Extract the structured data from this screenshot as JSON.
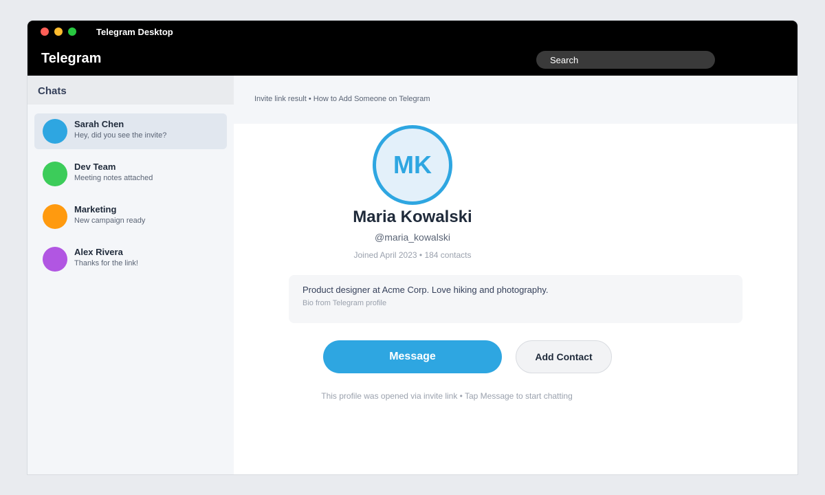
{
  "window": {
    "title": "Telegram Desktop"
  },
  "header": {
    "app_title": "Telegram",
    "search_placeholder": "Search"
  },
  "sidebar": {
    "title": "Chats",
    "chats": [
      {
        "name": "Sarah Chen",
        "preview": "Hey, did you see the invite?",
        "avatar_color": "#2ea6e1",
        "active": true
      },
      {
        "name": "Dev Team",
        "preview": "Meeting notes attached",
        "avatar_color": "#3ccc5a",
        "active": false
      },
      {
        "name": "Marketing",
        "preview": "New campaign ready",
        "avatar_color": "#ff9a0f",
        "active": false
      },
      {
        "name": "Alex Rivera",
        "preview": "Thanks for the link!",
        "avatar_color": "#b156e2",
        "active": false
      }
    ]
  },
  "main": {
    "breadcrumb": "Invite link result • How to Add Someone on Telegram",
    "profile": {
      "initials": "MK",
      "name": "Maria Kowalski",
      "username": "@maria_kowalski",
      "meta": "Joined April 2023 • 184 contacts",
      "bio": "Product designer at Acme Corp. Love hiking and photography.",
      "bio_source": "Bio from Telegram profile"
    },
    "buttons": {
      "message": "Message",
      "add_contact": "Add Contact"
    },
    "footer_note": "This profile was opened via invite link • Tap Message to start chatting"
  },
  "colors": {
    "accent": "#2ea6e1",
    "titlebar": "#000000"
  }
}
